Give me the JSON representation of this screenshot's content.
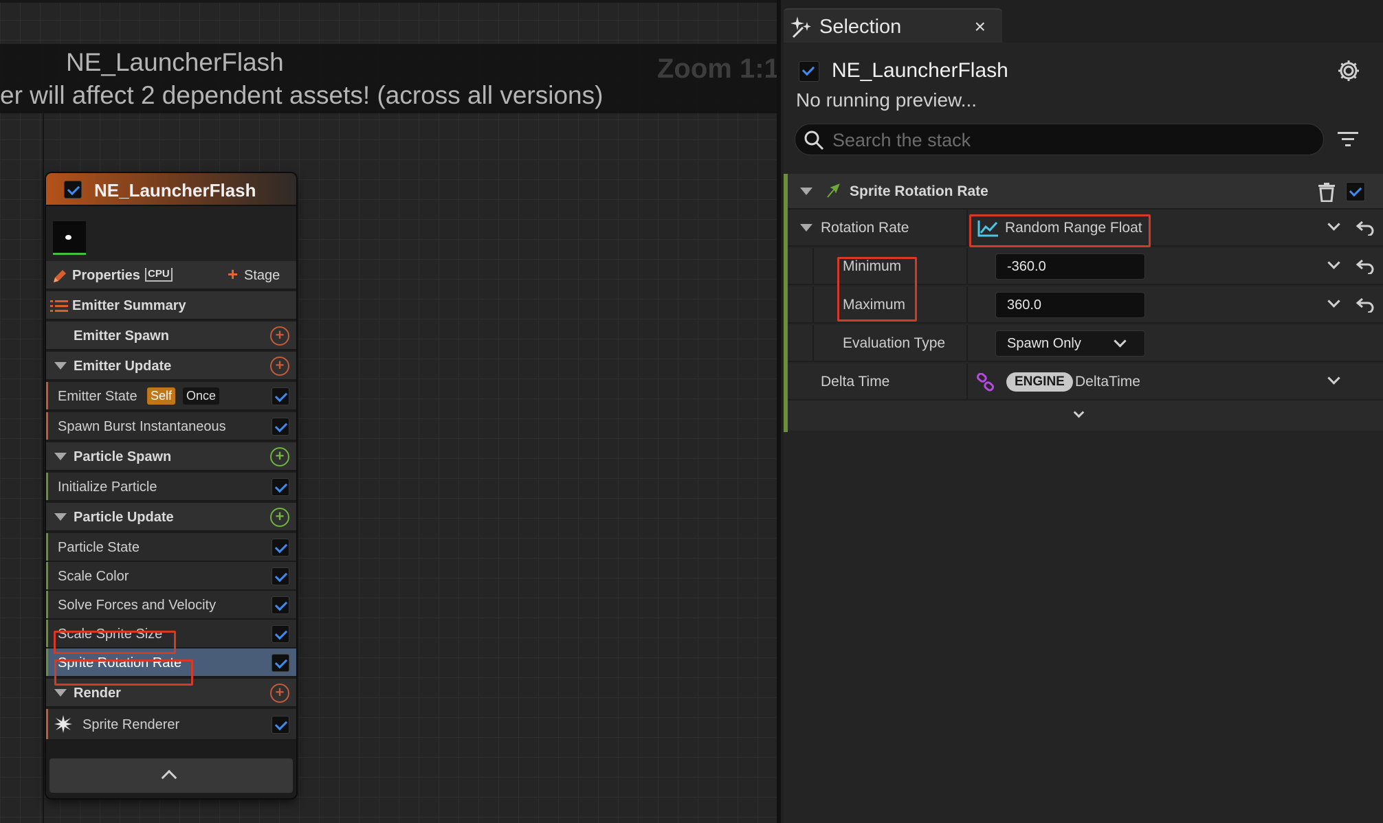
{
  "graph": {
    "title": "NE_LauncherFlash",
    "warning": "er will affect 2 dependent assets! (across all versions)",
    "zoom": "Zoom 1:1"
  },
  "node": {
    "title": "NE_LauncherFlash",
    "properties_label": "Properties",
    "cpu_label": "CPU",
    "stage_label": "Stage",
    "emitter_summary": "Emitter Summary",
    "emitter_spawn": "Emitter Spawn",
    "emitter_update": "Emitter Update",
    "emitter_state": "Emitter State",
    "badge_self": "Self",
    "badge_once": "Once",
    "spawn_burst": "Spawn Burst Instantaneous",
    "particle_spawn": "Particle Spawn",
    "initialize_particle": "Initialize Particle",
    "particle_update": "Particle Update",
    "particle_state": "Particle State",
    "scale_color": "Scale Color",
    "solve_forces": "Solve Forces and Velocity",
    "scale_sprite_size": "Scale Sprite Size",
    "sprite_rotation_rate": "Sprite Rotation Rate",
    "render": "Render",
    "sprite_renderer": "Sprite Renderer"
  },
  "panel": {
    "tab_title": "Selection",
    "tab_close": "×",
    "emitter_name": "NE_LauncherFlash",
    "preview_status": "No running preview...",
    "search_placeholder": "Search the stack",
    "module_title": "Sprite Rotation Rate",
    "rotation_rate_label": "Rotation Rate",
    "rotation_rate_value": "Random Range Float",
    "minimum_label": "Minimum",
    "minimum_value": "-360.0",
    "maximum_label": "Maximum",
    "maximum_value": "360.0",
    "evaluation_type_label": "Evaluation Type",
    "evaluation_type_value": "Spawn Only",
    "delta_time_label": "Delta Time",
    "engine_badge": "ENGINE",
    "delta_time_value": "DeltaTime"
  },
  "colors": {
    "accent_checkbox": "#3d8cf0",
    "highlight_box": "#d43a26",
    "node_header": "#b35219",
    "selected_row": "#4a5d78",
    "stage_plus": "#e8672c",
    "particle_plus": "#6fb43e"
  }
}
